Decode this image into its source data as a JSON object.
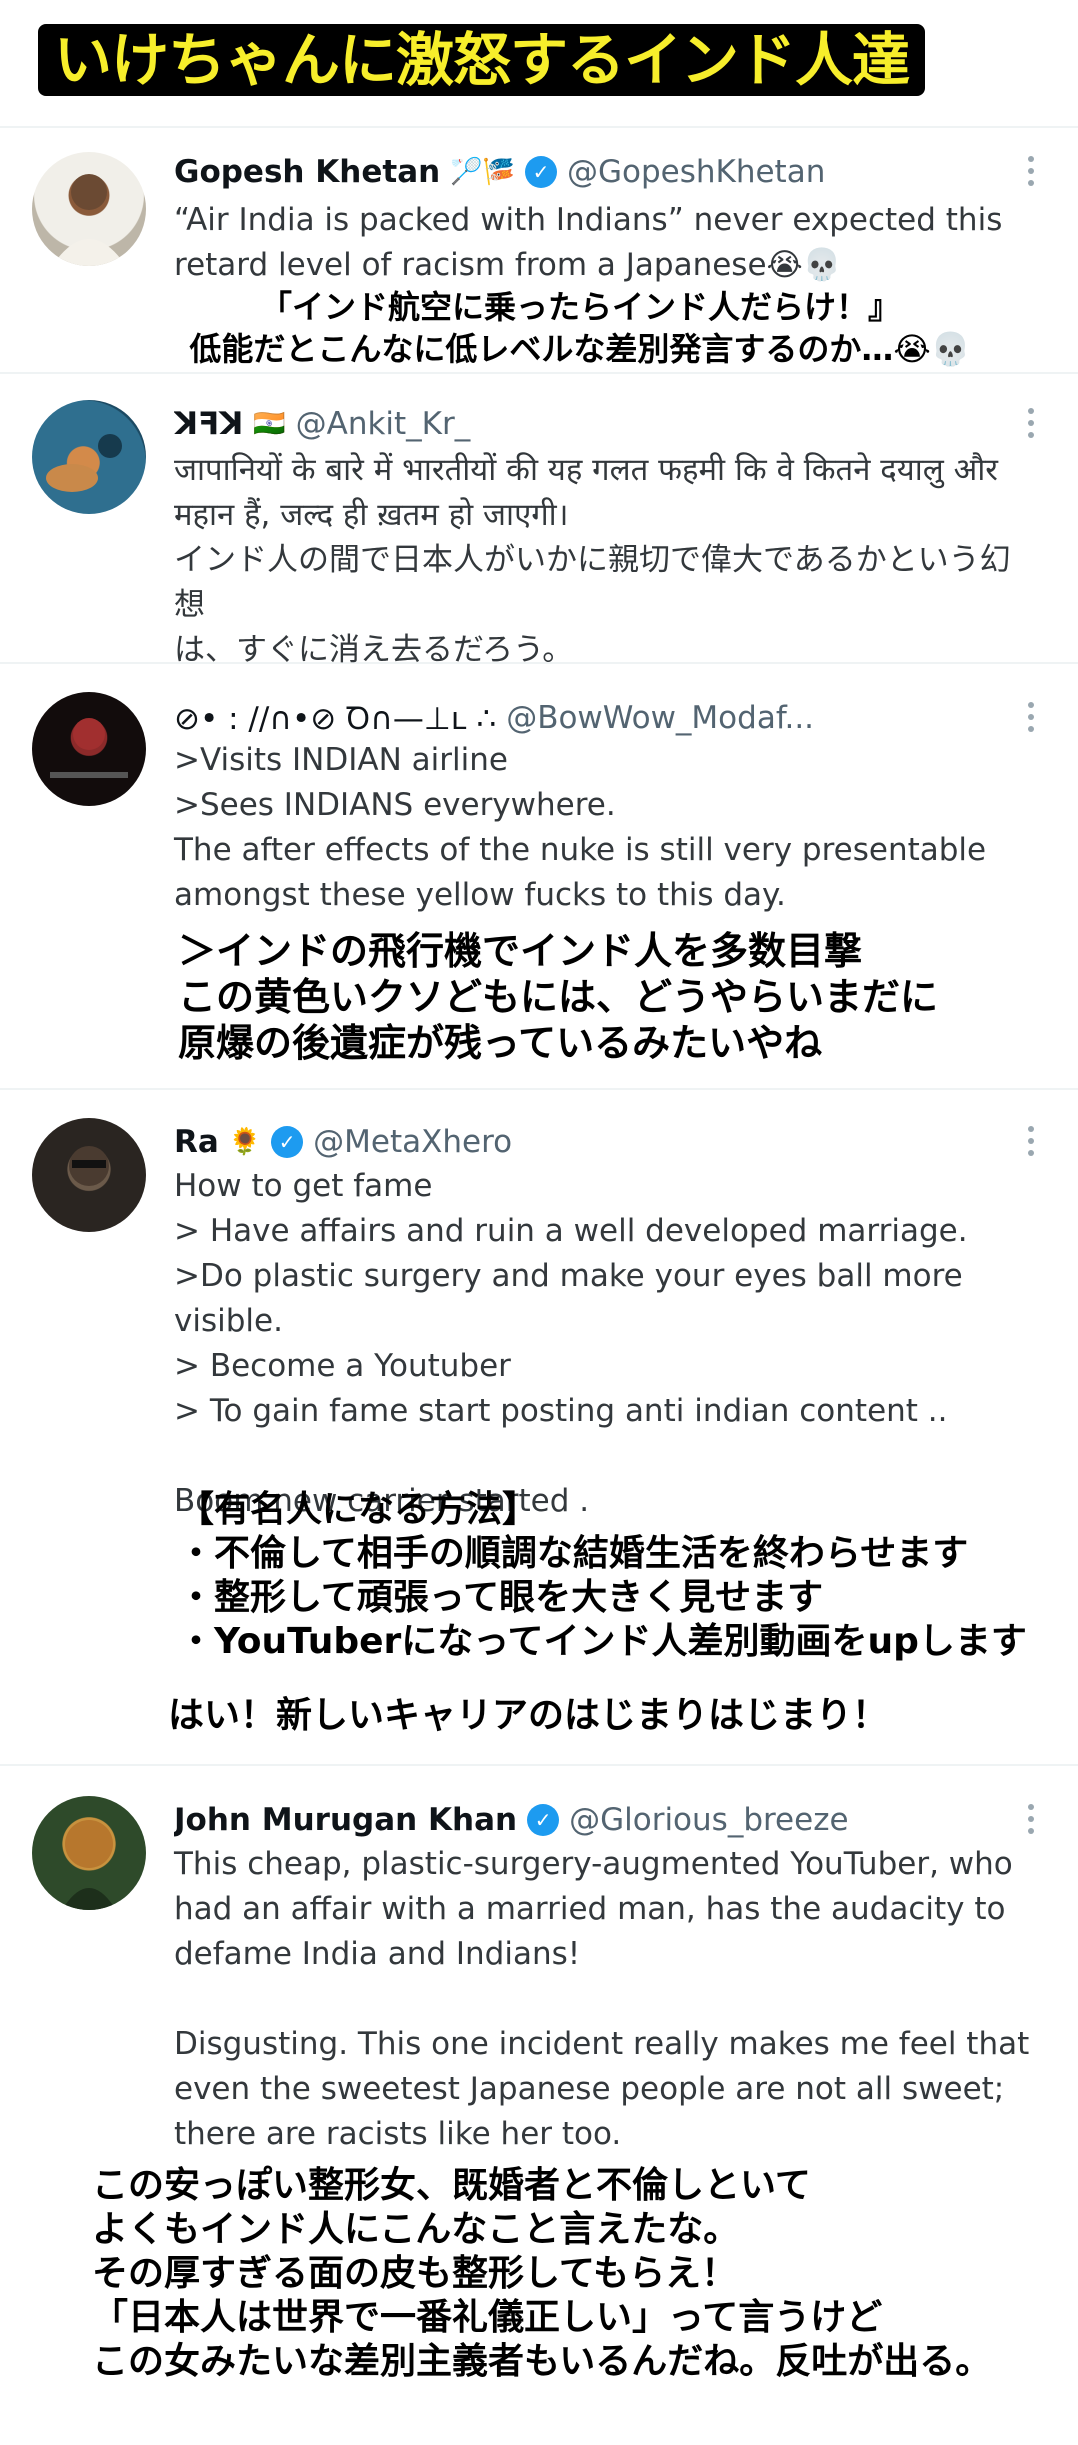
{
  "banner": {
    "title": "いけちゃんに激怒するインド人達"
  },
  "tweets": [
    {
      "name": "Gopesh Khetan",
      "name_emoji": "🏸🎏",
      "verified": true,
      "handle": "@GopeshKhetan",
      "text": "“Air India is packed with Indians” never expected this\nretard level of racism from a Japanese😭💀",
      "caption": "「インド航空に乗ったらインド人だらけ！』\n低能だとこんなに低レベルな差別発言するのか…😭💀"
    },
    {
      "name": "ꓘꟻꓘ",
      "name_emoji": "🇮🇳",
      "verified": false,
      "handle": "@Ankit_Kr_",
      "text": "जापानियों के बारे में भारतीयों की यह गलत फहमी कि वे कितने दयालु और\nमहान हैं, जल्द ही ख़तम हो जाएगी।\nインド人の間で日本人がいかに親切で偉大であるかという幻想\nは、すぐに消え去るだろう。",
      "caption": ""
    },
    {
      "name": "⊘• : //∩•⊘ Ꝺ∩—⊥ʟ ∴",
      "name_emoji": "",
      "verified": false,
      "handle": "@BowWow_Modaf...",
      "text": ">Visits INDIAN airline\n>Sees INDIANS everywhere.\nThe after effects of the nuke is still very presentable\namongst these yellow fucks to this day.",
      "caption": "＞インドの飛行機でインド人を多数目撃\nこの黄色いクソどもには、どうやらいまだに\n原爆の後遺症が残っているみたいやね"
    },
    {
      "name": "Ra",
      "name_emoji": "🌻",
      "verified": true,
      "handle": "@MetaXhero",
      "text": "How to get fame\n> Have affairs and ruin a well developed marriage.\n>Do plastic surgery and make your eyes ball more visible.\n> Become a Youtuber\n> To gain fame start posting anti indian content ..\n\nBoom new carrier started .",
      "caption": "【有名人になる方法】\n・不倫して相手の順調な結婚生活を終わらせます\n・整形して頑張って眼を大きく見せます\n・YouTuberになってインド人差別動画をupします",
      "caption2": "はい！新しいキャリアのはじまりはじまり！"
    },
    {
      "name": "John Murugan Khan",
      "name_emoji": "",
      "verified": true,
      "handle": "@Glorious_breeze",
      "text": "This cheap, plastic-surgery-augmented YouTuber, who\nhad an affair with a married man, has the audacity to\ndefame India and Indians!\n\nDisgusting. This one incident really makes me feel that\neven the sweetest Japanese people are not all sweet;\nthere are racists like her too.",
      "caption": "この安っぽい整形女、既婚者と不倫しといて\nよくもインド人にこんなこと言えたな。\nその厚すぎる面の皮も整形してもらえ！\n「日本人は世界で一番礼儀正しい」って言うけど\nこの女みたいな差別主義者もいるんだね。反吐が出る。"
    }
  ],
  "colors": {
    "banner_text": "#f7ee2b",
    "verified": "#1d9bf0",
    "handle": "#536471",
    "divider": "#eff3f4"
  },
  "icons": [
    "verified-badge-icon",
    "more-options-icon"
  ]
}
